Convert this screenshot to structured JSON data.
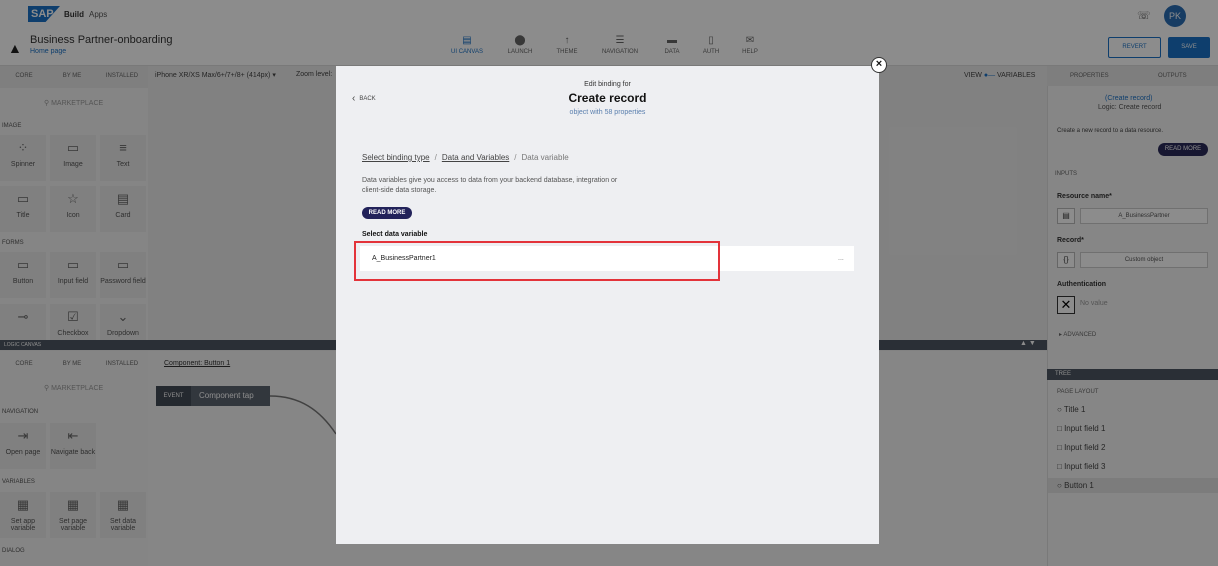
{
  "header": {
    "logo": "SAP",
    "brand": "Build",
    "section": "Apps",
    "avatar": "PK"
  },
  "app": {
    "title": "Business Partner-onboarding",
    "page_link": "Home page"
  },
  "nav_tabs": [
    {
      "label": "UI CANVAS",
      "icon": "▤"
    },
    {
      "label": "LAUNCH",
      "icon": "⬤"
    },
    {
      "label": "THEME",
      "icon": "↑"
    },
    {
      "label": "NAVIGATION",
      "icon": "☰"
    },
    {
      "label": "DATA",
      "icon": "▬"
    },
    {
      "label": "AUTH",
      "icon": "▯"
    },
    {
      "label": "HELP",
      "icon": "✉"
    }
  ],
  "actions": {
    "revert": "REVERT",
    "save": "SAVE"
  },
  "left_tabs": [
    "CORE",
    "BY ME",
    "INSTALLED"
  ],
  "marketplace": "MARKETPLACE",
  "sections": {
    "image": "IMAGE",
    "forms": "FORMS",
    "navigation": "NAVIGATION",
    "variables": "VARIABLES",
    "dialog": "DIALOG"
  },
  "tiles_top": [
    {
      "label": "Spinner",
      "icon": "⁘"
    },
    {
      "label": "Image",
      "icon": "▭"
    },
    {
      "label": "Text",
      "icon": "≡"
    },
    {
      "label": "Title",
      "icon": "▭"
    },
    {
      "label": "Icon",
      "icon": "☆"
    },
    {
      "label": "Card",
      "icon": "▤"
    },
    {
      "label": "Button",
      "icon": "▭"
    },
    {
      "label": "Input field",
      "icon": "▭"
    },
    {
      "label": "Password field",
      "icon": "▭"
    },
    {
      "label": "",
      "icon": "⊸"
    },
    {
      "label": "Checkbox",
      "icon": "☑"
    },
    {
      "label": "Dropdown",
      "icon": "⌄"
    }
  ],
  "tiles_bottom": [
    {
      "label": "Open page",
      "icon": "⇥"
    },
    {
      "label": "Navigate back",
      "icon": "⇤"
    },
    {
      "label": "Set app variable",
      "icon": "▦"
    },
    {
      "label": "Set page variable",
      "icon": "▦"
    },
    {
      "label": "Set data variable",
      "icon": "▦"
    }
  ],
  "canvas": {
    "device": "iPhone XR/XS Max/6+/7+/8+ (414px) ▾",
    "zoom": "Zoom level:",
    "view": "VIEW",
    "variables": "VARIABLES"
  },
  "logic": {
    "bar": "LOGIC CANVAS",
    "component_link": "Component: Button 1",
    "event": "EVENT",
    "event_label": "Component tap"
  },
  "right": {
    "tabs": [
      "PROPERTIES",
      "OUTPUTS"
    ],
    "link": "(Create record)",
    "subtitle": "Logic: Create record",
    "desc": "Create a new record to a data resource.",
    "read_more": "READ MORE",
    "inputs": "INPUTS",
    "resource_label": "Resource name*",
    "resource_value": "A_BusinessPartner",
    "record_label": "Record*",
    "record_value": "Custom object",
    "auth_label": "Authentication",
    "auth_value": "No value",
    "advanced": "▸ ADVANCED",
    "tree": "TREE",
    "page_layout": "PAGE LAYOUT",
    "tree_items": [
      "Title 1",
      "Input field 1",
      "Input field 2",
      "Input field 3",
      "Button 1"
    ]
  },
  "modal": {
    "back": "BACK",
    "pretitle": "Edit binding for",
    "title": "Create record",
    "subtitle": "object with 58 properties",
    "crumb1": "Select binding type",
    "crumb2": "Data and Variables",
    "crumb3": "Data variable",
    "sep": "/",
    "desc": "Data variables give you access to data from your backend database, integration or client-side data storage.",
    "read_more": "READ MORE",
    "select_label": "Select data variable",
    "option": "A_BusinessPartner1",
    "dots": "..."
  },
  "colors": {
    "accent": "#1b72c6",
    "highlight": "#e3333a",
    "dark_button": "#22225a"
  }
}
